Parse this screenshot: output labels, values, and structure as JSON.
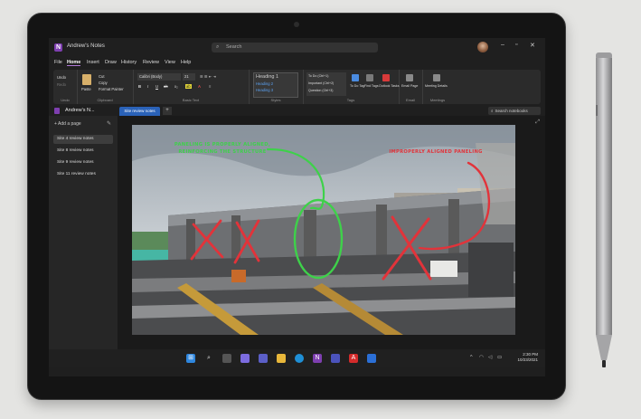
{
  "window": {
    "title": "Andrew's Notes",
    "search_placeholder": "Search"
  },
  "menu": [
    "File",
    "Home",
    "Insert",
    "Draw",
    "History",
    "Review",
    "View",
    "Help"
  ],
  "ribbon": {
    "undo": [
      "Undo",
      "Redo"
    ],
    "clipboard": {
      "paste": "Paste",
      "items": [
        "Cut",
        "Copy",
        "Format Painter"
      ],
      "label": "Clipboard"
    },
    "basic_text": {
      "font": "Calibri (Body)",
      "size": "21",
      "label": "Basic Text",
      "format_buttons": [
        "B",
        "I",
        "U",
        "ab",
        "x₂",
        "A"
      ]
    },
    "styles": {
      "items": [
        "Heading 1",
        "Heading 2",
        "Heading 3"
      ],
      "label": "Styles"
    },
    "tags": {
      "items": [
        "To Do (Ctrl+1)",
        "Important (Ctrl+2)",
        "Question (Ctrl+3)"
      ],
      "buttons": [
        "To Do Tag",
        "Find Tags",
        "Outlook Tasks"
      ],
      "label": "Tags"
    },
    "email": {
      "button": "Email Page",
      "label": "Email"
    },
    "meetings": {
      "button": "Meeting Details",
      "label": "Meetings"
    },
    "group_labels": [
      "Undo"
    ]
  },
  "notebook": {
    "name": "Andrew's N...",
    "active_section": "Site review notes",
    "search": "Search notebooks"
  },
  "sidebar": {
    "add_page": "Add a page",
    "pages": [
      "Site 4 review notes",
      "Site 8 review notes",
      "Site 9 review notes",
      "Site 11 review notes"
    ]
  },
  "annotations": {
    "green": [
      "PANELING IS PROPERLY ALIGNED,",
      "REINFORCING THE STRUCTURE"
    ],
    "red": [
      "IMPROPERLY ALIGNED PANELING"
    ]
  },
  "taskbar": {
    "time": "2:30 PM",
    "date": "10/23/2021"
  },
  "colors": {
    "accent": "#7e3fb0",
    "section_tab": "#2a62b8",
    "ink_green": "#3ed14a",
    "ink_red": "#e2333a"
  }
}
